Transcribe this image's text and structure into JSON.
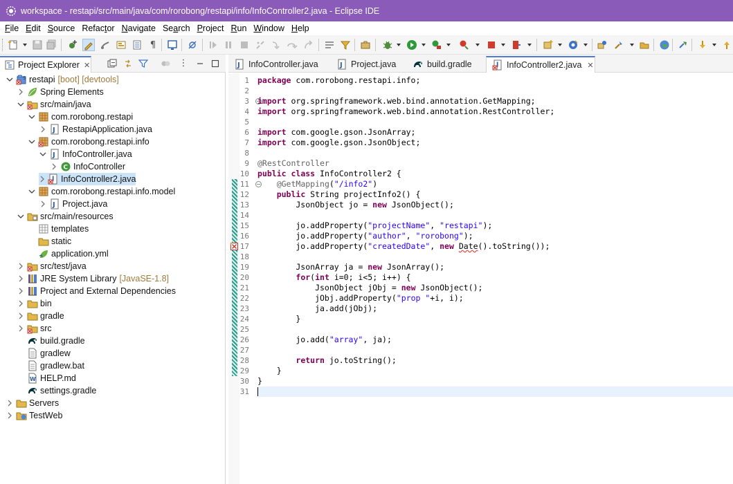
{
  "window": {
    "title": "workspace - restapi/src/main/java/com/rorobong/restapi/info/InfoController2.java - Eclipse IDE"
  },
  "menu": [
    {
      "label": "File",
      "mnemonic": "F"
    },
    {
      "label": "Edit",
      "mnemonic": "E"
    },
    {
      "label": "Source",
      "mnemonic": "S"
    },
    {
      "label": "Refactor",
      "mnemonic": "t"
    },
    {
      "label": "Navigate",
      "mnemonic": "N"
    },
    {
      "label": "Search",
      "mnemonic": "a"
    },
    {
      "label": "Project",
      "mnemonic": "P"
    },
    {
      "label": "Run",
      "mnemonic": "R"
    },
    {
      "label": "Window",
      "mnemonic": "W"
    },
    {
      "label": "Help",
      "mnemonic": "H"
    }
  ],
  "toolbar": {
    "icons": [
      "new-icon",
      "save-icon",
      "save-all-icon",
      "new-java-class-icon",
      "highlight-icon",
      "toggle-mark-icon",
      "open-type-icon",
      "open-task-icon",
      "show-whitespace-icon",
      "terminal-icon",
      "skip-breakpoints-icon",
      "resume-icon",
      "suspend-icon",
      "terminate-icon",
      "disconnect-icon",
      "step-into-icon",
      "step-over-icon",
      "step-return-icon",
      "drop-to-frame-icon",
      "use-step-filters-icon",
      "debug-icon",
      "run-icon",
      "coverage-icon",
      "external-tools-icon",
      "stop-icon",
      "new-server-icon",
      "new-package-icon",
      "open-perspective-icon",
      "search-icon",
      "globe-icon",
      "refresh-icon",
      "next-annotation-icon",
      "previous-annotation-icon"
    ]
  },
  "explorer": {
    "title": "Project Explorer",
    "tree": [
      {
        "label": "restapi",
        "decoration": "[boot] [devtools]",
        "icon": "project-icon",
        "level": 0,
        "state": "open"
      },
      {
        "label": "Spring Elements",
        "icon": "spring-icon",
        "level": 1,
        "state": "closed"
      },
      {
        "label": "src/main/java",
        "icon": "source-folder-icon",
        "level": 1,
        "state": "open"
      },
      {
        "label": "com.rorobong.restapi",
        "icon": "package-icon",
        "level": 2,
        "state": "open"
      },
      {
        "label": "RestapiApplication.java",
        "icon": "java-file-icon",
        "level": 3,
        "state": "closed"
      },
      {
        "label": "com.rorobong.restapi.info",
        "icon": "package-error-icon",
        "level": 2,
        "state": "open"
      },
      {
        "label": "InfoController.java",
        "icon": "java-file-icon",
        "level": 3,
        "state": "open"
      },
      {
        "label": "InfoController",
        "icon": "class-icon",
        "level": 4,
        "state": "closed"
      },
      {
        "label": "InfoController2.java",
        "icon": "java-file-error-icon",
        "level": 3,
        "state": "closed",
        "selected": true
      },
      {
        "label": "com.rorobong.restapi.info.model",
        "icon": "package-icon",
        "level": 2,
        "state": "open"
      },
      {
        "label": "Project.java",
        "icon": "java-file-icon",
        "level": 3,
        "state": "closed"
      },
      {
        "label": "src/main/resources",
        "icon": "resource-folder-icon",
        "level": 1,
        "state": "open"
      },
      {
        "label": "templates",
        "icon": "empty-package-icon",
        "level": 2,
        "state": "none"
      },
      {
        "label": "static",
        "icon": "folder-icon",
        "level": 2,
        "state": "none"
      },
      {
        "label": "application.yml",
        "icon": "yml-file-icon",
        "level": 2,
        "state": "none"
      },
      {
        "label": "src/test/java",
        "icon": "source-folder-icon",
        "level": 1,
        "state": "closed"
      },
      {
        "label": "JRE System Library",
        "decoration": "[JavaSE-1.8]",
        "icon": "library-icon",
        "level": 1,
        "state": "closed"
      },
      {
        "label": "Project and External Dependencies",
        "icon": "library-icon",
        "level": 1,
        "state": "closed"
      },
      {
        "label": "bin",
        "icon": "folder-icon",
        "level": 1,
        "state": "closed"
      },
      {
        "label": "gradle",
        "icon": "folder-icon",
        "level": 1,
        "state": "closed"
      },
      {
        "label": "src",
        "icon": "folder-error-icon",
        "level": 1,
        "state": "closed"
      },
      {
        "label": "build.gradle",
        "icon": "gradle-icon",
        "level": 1,
        "state": "none"
      },
      {
        "label": "gradlew",
        "icon": "text-file-icon",
        "level": 1,
        "state": "none"
      },
      {
        "label": "gradlew.bat",
        "icon": "text-file-icon",
        "level": 1,
        "state": "none"
      },
      {
        "label": "HELP.md",
        "icon": "word-file-icon",
        "level": 1,
        "state": "none"
      },
      {
        "label": "settings.gradle",
        "icon": "gradle-icon",
        "level": 1,
        "state": "none"
      },
      {
        "label": "Servers",
        "icon": "folder-icon",
        "level": 0,
        "state": "closed"
      },
      {
        "label": "TestWeb",
        "icon": "web-project-icon",
        "level": 0,
        "state": "closed"
      }
    ]
  },
  "editor": {
    "tabs": [
      {
        "label": "InfoController.java",
        "icon": "java-file-icon",
        "active": false
      },
      {
        "label": "Project.java",
        "icon": "java-file-icon",
        "active": false
      },
      {
        "label": "build.gradle",
        "icon": "gradle-icon",
        "active": false
      },
      {
        "label": "InfoController2.java",
        "icon": "java-file-error-icon",
        "active": true
      }
    ],
    "lines": [
      [
        {
          "t": "package",
          "c": "kw"
        },
        {
          "t": " com.rorobong.restapi.info;"
        }
      ],
      [],
      [
        {
          "t": "import",
          "c": "kw"
        },
        {
          "t": " org.springframework.web.bind.annotation.GetMapping;"
        }
      ],
      [
        {
          "t": "import",
          "c": "kw"
        },
        {
          "t": " org.springframework.web.bind.annotation.RestController;"
        }
      ],
      [],
      [
        {
          "t": "import",
          "c": "kw"
        },
        {
          "t": " com.google.gson.JsonArray;"
        }
      ],
      [
        {
          "t": "import",
          "c": "kw"
        },
        {
          "t": " com.google.gson.JsonObject;"
        }
      ],
      [],
      [
        {
          "t": "@RestController",
          "c": "ann"
        }
      ],
      [
        {
          "t": "public",
          "c": "kw"
        },
        {
          "t": " "
        },
        {
          "t": "class",
          "c": "kw"
        },
        {
          "t": " InfoController2 {"
        }
      ],
      [
        {
          "t": "    "
        },
        {
          "t": "@GetMapping",
          "c": "ann"
        },
        {
          "t": "("
        },
        {
          "t": "\"/info2\"",
          "c": "str"
        },
        {
          "t": ")"
        }
      ],
      [
        {
          "t": "    "
        },
        {
          "t": "public",
          "c": "kw"
        },
        {
          "t": " String projectInfo2() {"
        }
      ],
      [
        {
          "t": "        JsonObject jo = "
        },
        {
          "t": "new",
          "c": "kw"
        },
        {
          "t": " JsonObject();"
        }
      ],
      [],
      [
        {
          "t": "        jo.addProperty("
        },
        {
          "t": "\"projectName\"",
          "c": "str"
        },
        {
          "t": ", "
        },
        {
          "t": "\"restapi\"",
          "c": "str"
        },
        {
          "t": ");"
        }
      ],
      [
        {
          "t": "        jo.addProperty("
        },
        {
          "t": "\"author\"",
          "c": "str"
        },
        {
          "t": ", "
        },
        {
          "t": "\"rorobong\"",
          "c": "str"
        },
        {
          "t": ");"
        }
      ],
      [
        {
          "t": "        jo.addProperty("
        },
        {
          "t": "\"createdDate\"",
          "c": "str"
        },
        {
          "t": ", "
        },
        {
          "t": "new",
          "c": "kw"
        },
        {
          "t": " "
        },
        {
          "t": "Date",
          "c": "squig"
        },
        {
          "t": "().toString());"
        }
      ],
      [],
      [
        {
          "t": "        JsonArray ja = "
        },
        {
          "t": "new",
          "c": "kw"
        },
        {
          "t": " JsonArray();"
        }
      ],
      [
        {
          "t": "        "
        },
        {
          "t": "for",
          "c": "kw"
        },
        {
          "t": "("
        },
        {
          "t": "int",
          "c": "kw"
        },
        {
          "t": " i=0; i<5; i++) {"
        }
      ],
      [
        {
          "t": "            JsonObject jObj = "
        },
        {
          "t": "new",
          "c": "kw"
        },
        {
          "t": " JsonObject();"
        }
      ],
      [
        {
          "t": "            jObj.addProperty("
        },
        {
          "t": "\"prop \"",
          "c": "str"
        },
        {
          "t": "+i, i);"
        }
      ],
      [
        {
          "t": "            ja.add(jObj);"
        }
      ],
      [
        {
          "t": "        }"
        }
      ],
      [],
      [
        {
          "t": "        jo.add("
        },
        {
          "t": "\"array\"",
          "c": "str"
        },
        {
          "t": ", ja);"
        }
      ],
      [],
      [
        {
          "t": "        "
        },
        {
          "t": "return",
          "c": "kw"
        },
        {
          "t": " jo.toString();"
        }
      ],
      [
        {
          "t": "    }"
        }
      ],
      [
        {
          "t": "}"
        }
      ],
      []
    ],
    "line_numbers": [
      "1",
      "2",
      "3",
      "4",
      "5",
      "6",
      "7",
      "8",
      "9",
      "10",
      "11",
      "12",
      "13",
      "14",
      "15",
      "16",
      "17",
      "18",
      "19",
      "20",
      "21",
      "22",
      "23",
      "24",
      "25",
      "26",
      "27",
      "28",
      "29",
      "30",
      "31"
    ],
    "current_line": 31,
    "error_line": 17
  }
}
